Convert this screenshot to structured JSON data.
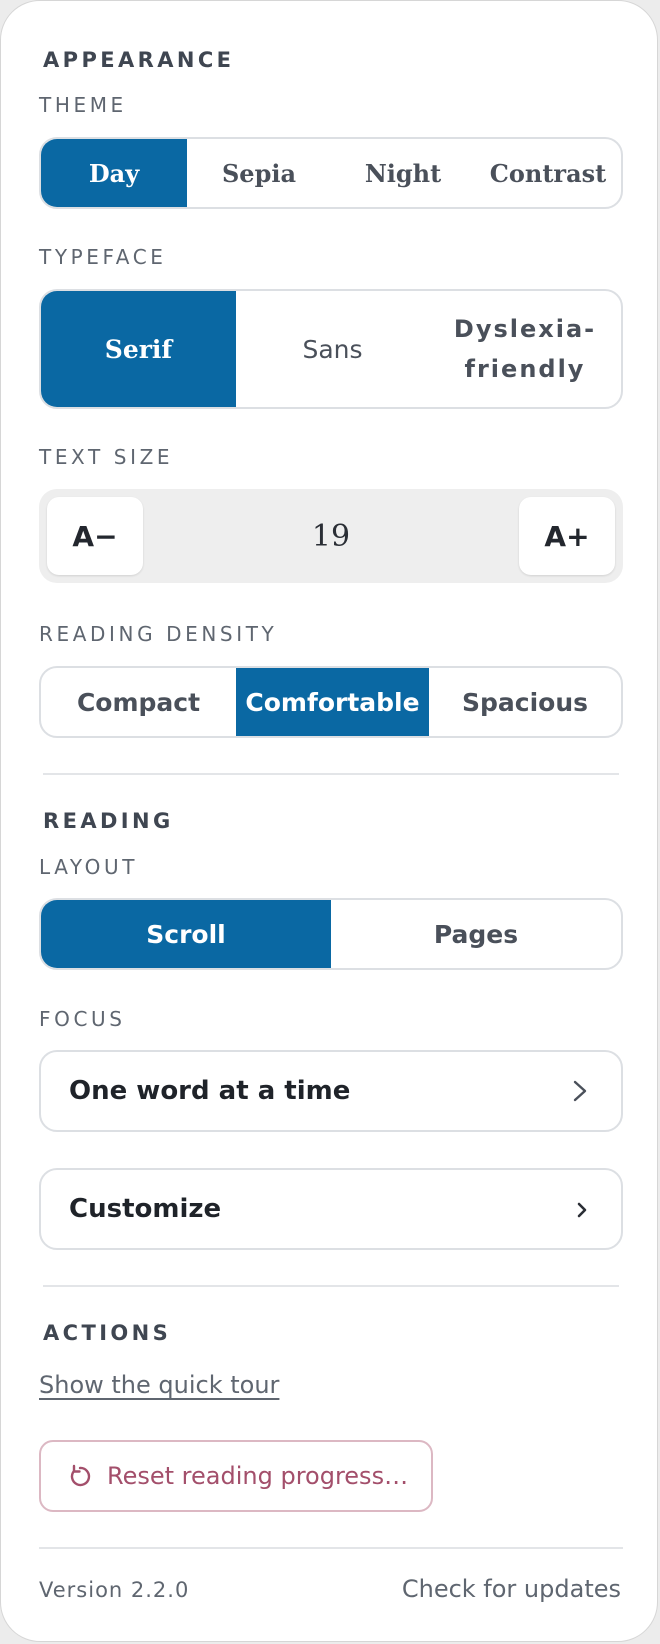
{
  "appearance": {
    "heading": "APPEARANCE",
    "theme": {
      "label": "THEME",
      "options": [
        "Day",
        "Sepia",
        "Night",
        "Contrast"
      ],
      "selected": "Day"
    },
    "typeface": {
      "label": "TYPEFACE",
      "options": [
        "Serif",
        "Sans",
        "Dyslexia-\nfriendly"
      ],
      "selected": "Serif"
    },
    "text_size": {
      "label": "TEXT SIZE",
      "decrease": "A−",
      "value": "19",
      "increase": "A+"
    },
    "density": {
      "label": "READING DENSITY",
      "options": [
        "Compact",
        "Comfortable",
        "Spacious"
      ],
      "selected": "Comfortable"
    }
  },
  "reading": {
    "heading": "READING",
    "layout": {
      "label": "LAYOUT",
      "options": [
        "Scroll",
        "Pages"
      ],
      "selected": "Scroll"
    },
    "focus": {
      "label": "FOCUS",
      "value": "One word at a time",
      "icon": "chevron-right-icon"
    },
    "customize": {
      "label": "Customize",
      "icon": "chevron-right-icon"
    }
  },
  "actions": {
    "heading": "ACTIONS",
    "tour_link": "Show the quick tour",
    "reset": {
      "label": "Reset reading progress…",
      "icon": "reset-icon"
    }
  },
  "footer": {
    "version": "Version 2.2.0",
    "check_updates": "Check for updates"
  },
  "colors": {
    "accent": "#0a68a3",
    "danger": "#a34f6b",
    "danger_border": "#dcb8c3"
  }
}
